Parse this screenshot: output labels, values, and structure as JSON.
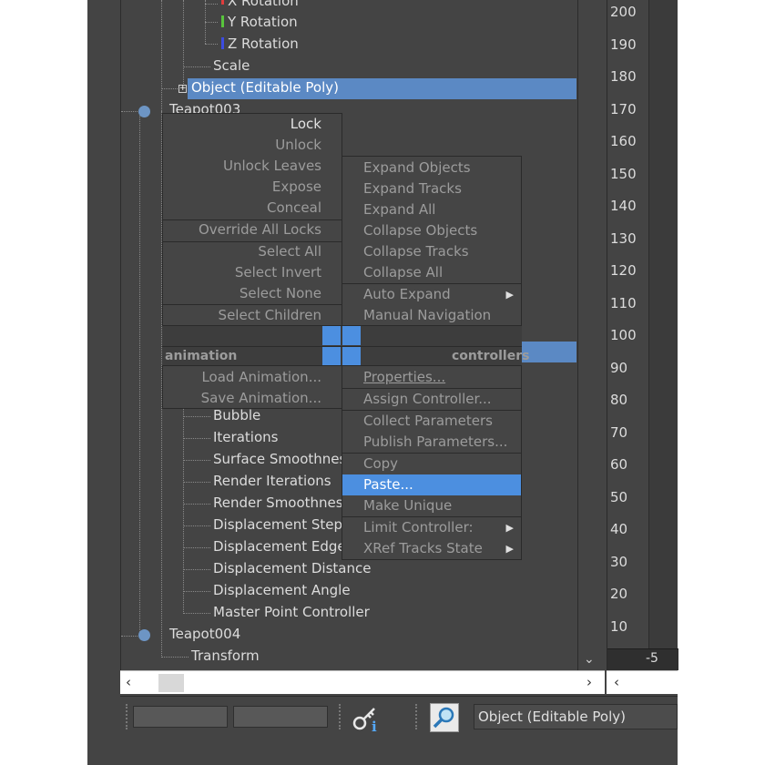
{
  "tree": {
    "items": [
      {
        "label": "X Rotation",
        "color": "#e03c3c"
      },
      {
        "label": "Y Rotation",
        "color": "#58c43c"
      },
      {
        "label": "Z Rotation",
        "color": "#3c4ce0"
      },
      {
        "label": "Scale"
      },
      {
        "label": "Object (Editable Poly)",
        "selected": true
      },
      {
        "label": "Teapot003"
      },
      {
        "label": "Bubble"
      },
      {
        "label": "Iterations"
      },
      {
        "label": "Surface Smoothness"
      },
      {
        "label": "Render Iterations"
      },
      {
        "label": "Render Smoothness"
      },
      {
        "label": "Displacement Steps"
      },
      {
        "label": "Displacement Edge"
      },
      {
        "label": "Displacement Distance"
      },
      {
        "label": "Displacement Angle"
      },
      {
        "label": "Master Point Controller"
      },
      {
        "label": "Teapot004"
      },
      {
        "label": "Transform"
      }
    ]
  },
  "ruler": {
    "labels": [
      "200",
      "190",
      "180",
      "170",
      "160",
      "150",
      "140",
      "130",
      "120",
      "110",
      "100",
      "90",
      "80",
      "70",
      "60",
      "50",
      "40",
      "30",
      "20",
      "10"
    ],
    "bottom": "-5"
  },
  "quad_menu": {
    "left_title": "animation",
    "right_title": "controllers",
    "left_top": [
      "Lock",
      "Unlock",
      "Unlock Leaves",
      "Expose",
      "Conceal",
      "Override All Locks",
      "Select All",
      "Select Invert",
      "Select None",
      "Select Children"
    ],
    "left_bottom": [
      "Load Animation...",
      "Save Animation..."
    ],
    "right_top": [
      "Expand Objects",
      "Expand Tracks",
      "Expand All",
      "Collapse Objects",
      "Collapse Tracks",
      "Collapse All",
      "Auto Expand",
      "Manual Navigation"
    ],
    "right_bottom": [
      "Properties...",
      "Assign Controller...",
      "Collect Parameters",
      "Publish Parameters...",
      "Copy",
      "Paste...",
      "Make Unique",
      "Limit Controller:",
      "XRef Tracks State"
    ]
  },
  "status_bar": {
    "selected_name": "Object (Editable Poly)"
  },
  "icons": {
    "key_info": "key-info-icon",
    "zoom": "zoom-magnifier-icon",
    "scroll_down": "chevron-down-icon",
    "scroll_left": "chevron-left-icon",
    "scroll_right": "chevron-right-icon",
    "submenu": "triangle-right-icon"
  },
  "colors": {
    "highlight": "#4c8fe0",
    "selection": "#5b89c4",
    "panel": "#444444",
    "node": "#6d95c4"
  }
}
